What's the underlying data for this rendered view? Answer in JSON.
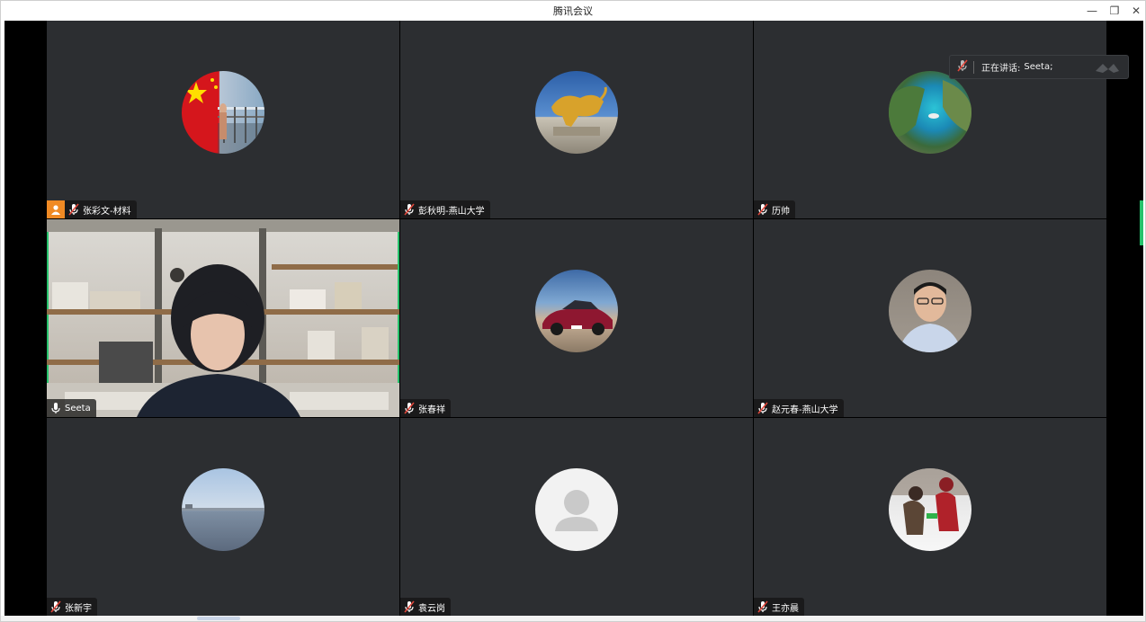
{
  "window": {
    "title": "腾讯会议",
    "minimize": "—",
    "restore": "❐",
    "close": "✕"
  },
  "speaker": {
    "label": "正在讲话:",
    "name": "Seeta;"
  },
  "participants": [
    {
      "name": "张彩文-材料",
      "host": true,
      "avatar": "china-flag-photo",
      "muted": true
    },
    {
      "name": "彭秋明-燕山大学",
      "host": false,
      "avatar": "golden-bull-photo",
      "muted": true
    },
    {
      "name": "历帅",
      "host": false,
      "avatar": "coast-cliff-photo",
      "muted": true
    },
    {
      "name": "Seeta",
      "host": false,
      "avatar": "live-video",
      "muted": false
    },
    {
      "name": "张春祥",
      "host": false,
      "avatar": "red-car-photo",
      "muted": true
    },
    {
      "name": "赵元春-燕山大学",
      "host": false,
      "avatar": "man-portrait-photo",
      "muted": true
    },
    {
      "name": "张新宇",
      "host": false,
      "avatar": "sea-horizon-photo",
      "muted": true
    },
    {
      "name": "袁云岗",
      "host": false,
      "avatar": "default-avatar",
      "muted": true
    },
    {
      "name": "王亦晨",
      "host": false,
      "avatar": "snow-kids-photo",
      "muted": true
    }
  ],
  "colors": {
    "tile_bg": "#2c2e31",
    "active_border": "#27c26c",
    "host_badge": "#f08a24",
    "mute_red": "#e0463a"
  }
}
